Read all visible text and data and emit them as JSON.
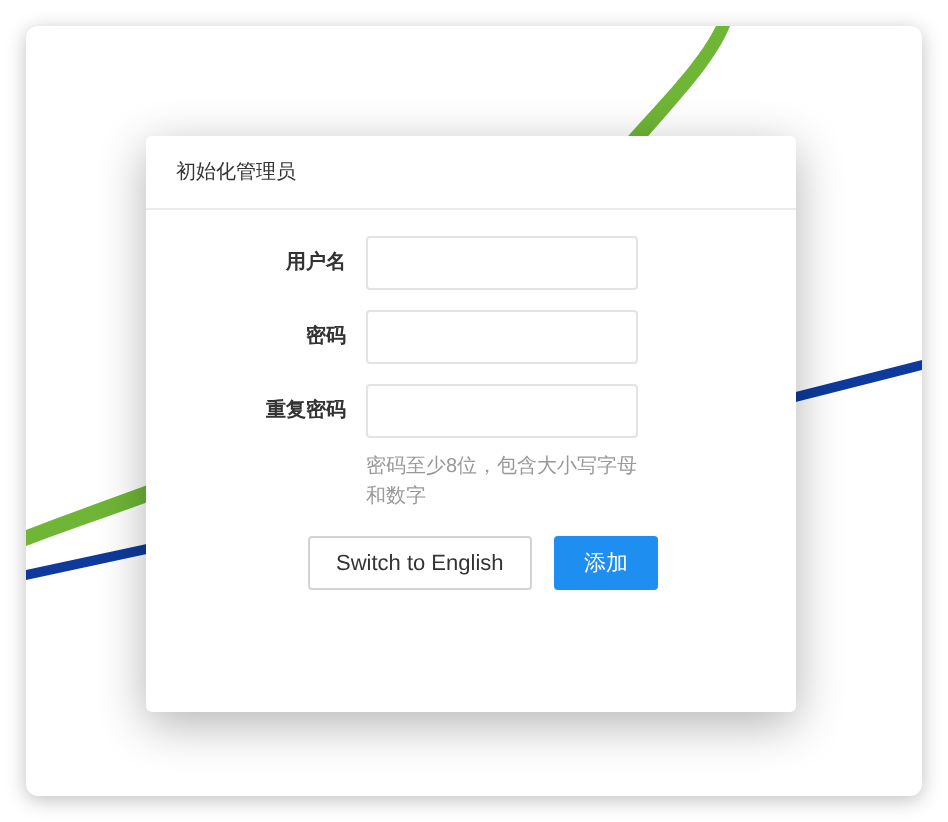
{
  "dialog": {
    "title": "初始化管理员"
  },
  "fields": [
    {
      "label": "用户名"
    },
    {
      "label": "密码"
    },
    {
      "label": "重复密码",
      "hint": "密码至少8位，包含大小写字母和数字"
    }
  ],
  "buttons": [
    {
      "label": "Switch to English",
      "kind": "default"
    },
    {
      "label": "添加",
      "kind": "primary"
    }
  ]
}
